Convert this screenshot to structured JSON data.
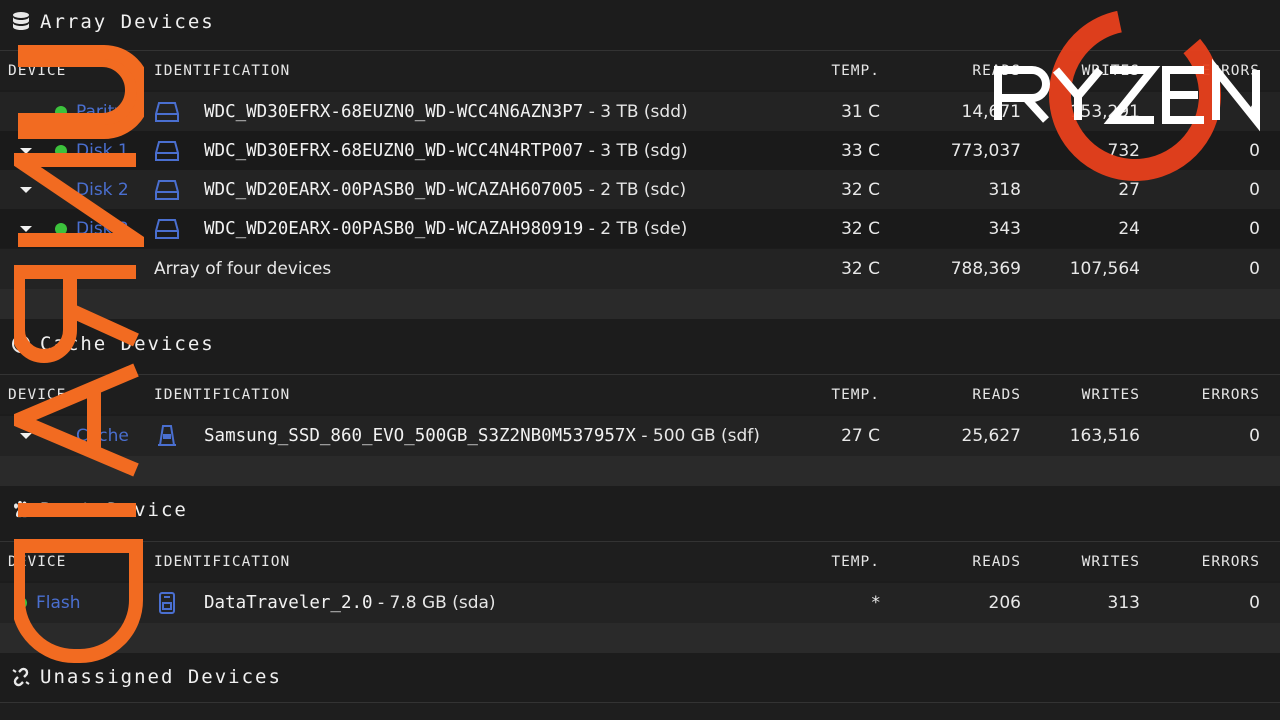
{
  "array_section": {
    "title": "Array Devices",
    "icon": "database-icon",
    "headers": {
      "device": "DEVICE",
      "identification": "IDENTIFICATION",
      "temp": "TEMP.",
      "reads": "READS",
      "writes": "WRITES",
      "errors": "ERRORS"
    },
    "rows": [
      {
        "name": "Parity",
        "id": "WDC_WD30EFRX-68EUZN0_WD-WCC4N6AZN3P7",
        "size": " - 3 TB (sdd)",
        "temp": "31 C",
        "reads": "14,671",
        "writes": "153,291",
        "errors": "0",
        "status": "green"
      },
      {
        "name": "Disk 1",
        "id": "WDC_WD30EFRX-68EUZN0_WD-WCC4N4RTP007",
        "size": " - 3 TB (sdg)",
        "temp": "33 C",
        "reads": "773,037",
        "writes": "732",
        "errors": "0",
        "status": "green"
      },
      {
        "name": "Disk 2",
        "id": "WDC_WD20EARX-00PASB0_WD-WCAZAH607005",
        "size": " - 2 TB (sdc)",
        "temp": "32 C",
        "reads": "318",
        "writes": "27",
        "errors": "0",
        "status": "green"
      },
      {
        "name": "Disk 3",
        "id": "WDC_WD20EARX-00PASB0_WD-WCAZAH980919",
        "size": " - 2 TB (sde)",
        "temp": "32 C",
        "reads": "343",
        "writes": "24",
        "errors": "0",
        "status": "green"
      }
    ],
    "summary": {
      "label": "Array of four devices",
      "temp": "32 C",
      "reads": "788,369",
      "writes": "107,564",
      "errors": "0"
    }
  },
  "cache_section": {
    "title": "Cache Devices",
    "icon": "target-icon",
    "headers": {
      "device": "DEVICE",
      "identification": "IDENTIFICATION",
      "temp": "TEMP.",
      "reads": "READS",
      "writes": "WRITES",
      "errors": "ERRORS"
    },
    "rows": [
      {
        "name": "Cache",
        "id": "Samsung_SSD_860_EVO_500GB_S3Z2NB0M537957X",
        "size": " - 500 GB (sdf)",
        "temp": "27 C",
        "reads": "25,627",
        "writes": "163,516",
        "errors": "0"
      }
    ]
  },
  "boot_section": {
    "title": "Boot Device",
    "icon": "paw-icon",
    "headers": {
      "device": "DEVICE",
      "identification": "IDENTIFICATION",
      "temp": "TEMP.",
      "reads": "READS",
      "writes": "WRITES",
      "errors": "ERRORS"
    },
    "rows": [
      {
        "name": "Flash",
        "id": "DataTraveler_2.0",
        "size": " - 7.8 GB (sda)",
        "temp": "*",
        "reads": "206",
        "writes": "313",
        "errors": "0",
        "status": "green"
      }
    ]
  },
  "unassigned_section": {
    "title": "Unassigned Devices",
    "icon": "unlink-icon"
  },
  "watermarks": {
    "left_text": "UNRAID",
    "right_text": "RYZEN",
    "left_color": "#f26b21",
    "right_color": "#ffffff",
    "ring_color": "#e8401c"
  },
  "colors": {
    "status_green": "#3cc23c",
    "device_link": "#4a6fd0",
    "disk_icon": "#4a6fd0"
  }
}
